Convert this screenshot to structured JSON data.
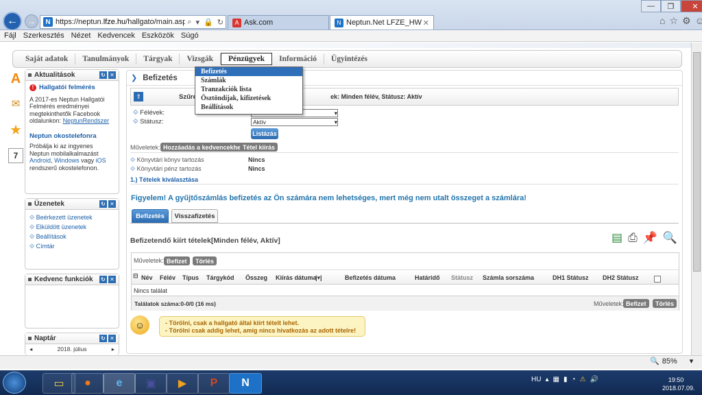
{
  "browser": {
    "url_prefix": "https://neptun.",
    "url_domain": "lfze.hu",
    "url_rest": "/hallgato/main.aspx?ismenu",
    "tabs": [
      {
        "label": "Ask.com"
      },
      {
        "label": "Neptun.Net LFZE_HW"
      }
    ]
  },
  "menubar": [
    "Fájl",
    "Szerkesztés",
    "Nézet",
    "Kedvencek",
    "Eszközök",
    "Súgó"
  ],
  "topnav": [
    "Saját adatok",
    "Tanulmányok",
    "Tárgyak",
    "Vizsgák",
    "Pénzügyek",
    "Információ",
    "Ügyintézés"
  ],
  "dropdown": [
    "Befizetés",
    "Számlák",
    "Tranzakciók lista",
    "Ösztöndíjak, kifizetések",
    "Beállítások"
  ],
  "sidebar": {
    "news": {
      "title": "Aktualitások",
      "item1_title": "Hallgatói felmérés",
      "item1_text": "A 2017-es Neptun Hallgatói Felmérés eredményei megtekinthetők Facebook oldalunkon:",
      "item1_link": "NeptunRendszer",
      "item2_title": "Neptun okostelefonra",
      "item2_text_a": "Próbálja ki az ingyenes Neptun mobilalkalmazást",
      "item2_link_a": "Android",
      "item2_text_b": ",",
      "item2_link_b": "Windows",
      "item2_text_c": " vagy ",
      "item2_link_c": "iOS",
      "item2_text_d": " rendszerű okostelefonon."
    },
    "messages": {
      "title": "Üzenetek",
      "links": [
        "Beérkezett üzenetek",
        "Elküldött üzenetek",
        "Beállítások",
        "Címtár"
      ]
    },
    "favorites": {
      "title": "Kedvenc funkciók"
    },
    "calendar": {
      "title": "Naptár",
      "month": "2018. július"
    }
  },
  "main": {
    "title": "Befizetés",
    "filter_label": "Szűrés",
    "filter_summary": "ek: Minden félév, Státusz: Aktív",
    "felevek_label": "Félévek:",
    "statusz_label": "Státusz:",
    "statusz_value": "Aktív",
    "list_button": "Listázás",
    "ops_label": "Műveletek:",
    "ops_add_fav": "Hozzáadás a kedvencekhez",
    "ops_print": "Tétel kiírás",
    "library_book_label": "Könyvtári könyv tartozás",
    "library_book_value": "Nincs",
    "library_money_label": "Könyvtári pénz tartozás",
    "library_money_value": "Nincs",
    "step": "1.) Tételek kiválasztása",
    "warning": "Figyelem! A gyűjtőszámlás befizetés az Ön számára nem lehetséges, mert még nem utalt összeget a számlára!",
    "tabs": [
      "Befizetés",
      "Visszafizetés"
    ],
    "list_title": "Befizetendő kiírt tételek[Minden félév, Aktív]",
    "table_ops_label": "Műveletek:",
    "btn_pay": "Befizet",
    "btn_delete": "Törlés",
    "columns": [
      "Név",
      "Félév",
      "Típus",
      "Tárgykód",
      "Összeg",
      "Kiírás dátuma",
      "Befizetés dátuma",
      "Határidő",
      "Státusz",
      "Számla sorszáma",
      "DH1 Státusz",
      "DH2 Státusz"
    ],
    "no_result": "Nincs találat",
    "result_count": "Találatok száma:0-0/0 (16 ms)",
    "note_line1": "- Törölni, csak a hallgató által kiírt tételt lehet.",
    "note_line2": "- Törölni csak addig lehet, amíg nincs hivatkozás az adott tételre!"
  },
  "statusbar": {
    "zoom": "85%"
  },
  "taskbar": {
    "lang": "HU",
    "time": "19:50",
    "date": "2018.07.09."
  }
}
